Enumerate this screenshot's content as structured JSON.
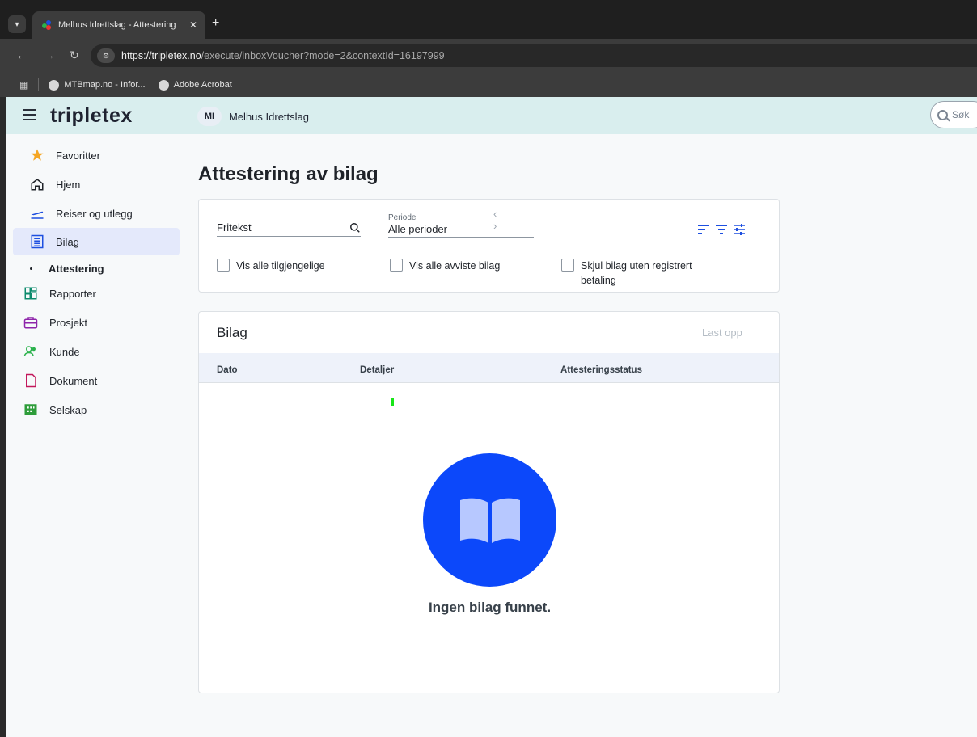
{
  "browser": {
    "tab_title": "Melhus Idrettslag - Attestering",
    "close_glyph": "✕",
    "new_tab_glyph": "+",
    "url_host": "https://tripletex.no",
    "url_path": "/execute/inboxVoucher?mode=2&contextId=16197999",
    "bookmarks": [
      {
        "label": "MTBmap.no - Infor...",
        "icon": "globe-icon"
      },
      {
        "label": "Adobe Acrobat",
        "icon": "globe-icon"
      }
    ]
  },
  "header": {
    "logo": "tripletex",
    "company_initials": "MI",
    "company_name": "Melhus Idrettslag",
    "search_placeholder": "Søk"
  },
  "sidebar": {
    "items": [
      {
        "label": "Favoritter",
        "icon": "star-icon",
        "color": "#f5a623"
      },
      {
        "label": "Hjem",
        "icon": "home-icon",
        "color": "#1f2329"
      },
      {
        "label": "Reiser og utlegg",
        "icon": "plane-icon",
        "color": "#1d4fe0"
      },
      {
        "label": "Bilag",
        "icon": "document-list-icon",
        "color": "#1d4fe0"
      },
      {
        "label": "Attestering",
        "icon": "",
        "color": ""
      },
      {
        "label": "Rapporter",
        "icon": "dashboard-icon",
        "color": "#0c8a6c"
      },
      {
        "label": "Prosjekt",
        "icon": "briefcase-icon",
        "color": "#8e24aa"
      },
      {
        "label": "Kunde",
        "icon": "people-icon",
        "color": "#2bb24c"
      },
      {
        "label": "Dokument",
        "icon": "file-icon",
        "color": "#c2185b"
      },
      {
        "label": "Selskap",
        "icon": "building-icon",
        "color": "#2e9d3a"
      }
    ]
  },
  "main": {
    "title": "Attestering av bilag",
    "filters": {
      "search_label": "Fritekst",
      "period_label": "Periode",
      "period_value": "Alle perioder",
      "period_arrows": "‹ ›",
      "checkboxes": [
        {
          "label": "Vis alle tilgjengelige",
          "checked": false
        },
        {
          "label": "Vis alle avviste bilag",
          "checked": false
        },
        {
          "label": "Skjul bilag uten registrert betaling",
          "checked": false
        }
      ]
    },
    "list": {
      "title": "Bilag",
      "upload_label": "Last opp",
      "columns": [
        "Dato",
        "Detaljer",
        "Attesteringsstatus"
      ],
      "empty_message": "Ingen bilag funnet."
    }
  },
  "colors": {
    "accent": "#0c48fa",
    "header_bg": "#d9eeee",
    "active_nav": "#e4e9fb"
  }
}
